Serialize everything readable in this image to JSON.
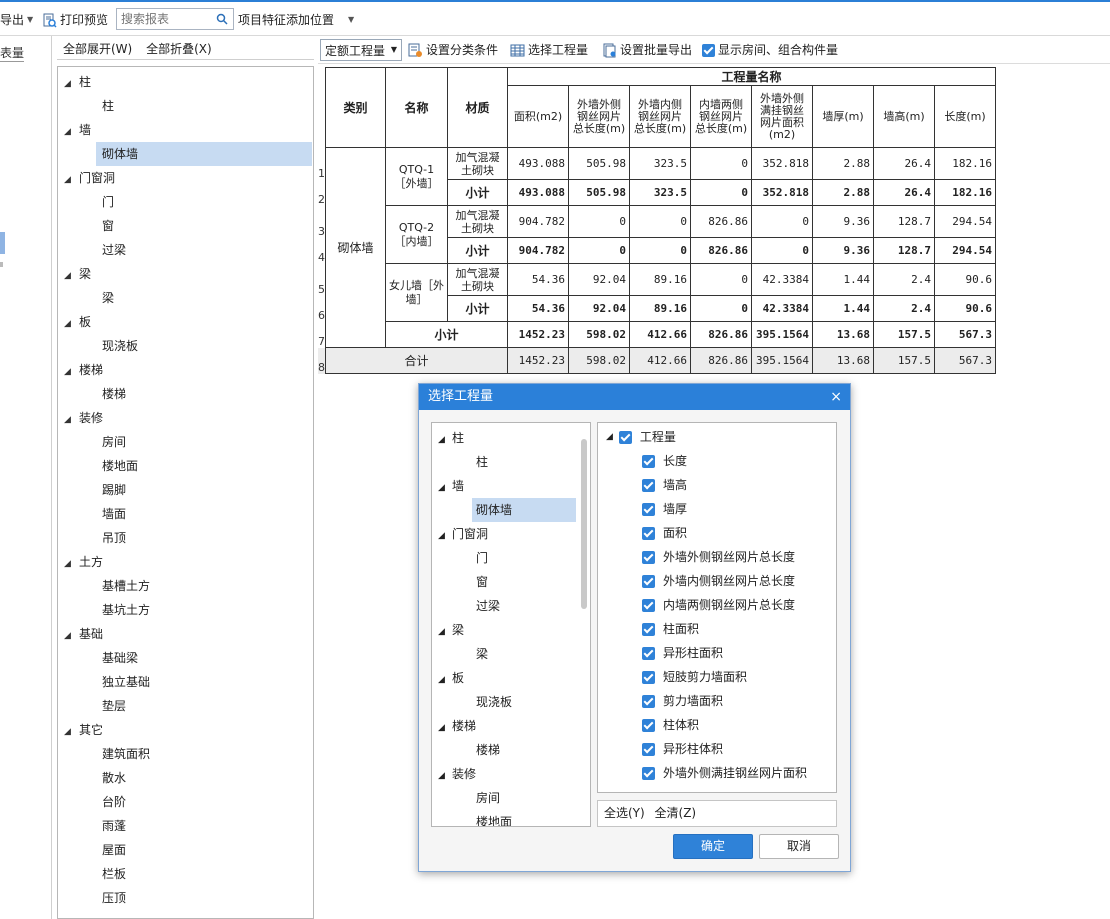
{
  "toolbar": {
    "export_label": "导出",
    "print_preview_label": "打印预览",
    "search_placeholder": "搜索报表",
    "feature_position_label": "项目特征添加位置"
  },
  "left_strip": {
    "tab_label": "表量"
  },
  "tree_panel": {
    "expand_all": "全部展开(W)",
    "collapse_all": "全部折叠(X)",
    "nodes": [
      {
        "label": "柱",
        "type": "group"
      },
      {
        "label": "柱",
        "type": "leaf"
      },
      {
        "label": "墙",
        "type": "group"
      },
      {
        "label": "砌体墙",
        "type": "leaf",
        "selected": true
      },
      {
        "label": "门窗洞",
        "type": "group"
      },
      {
        "label": "门",
        "type": "leaf"
      },
      {
        "label": "窗",
        "type": "leaf"
      },
      {
        "label": "过梁",
        "type": "leaf"
      },
      {
        "label": "梁",
        "type": "group"
      },
      {
        "label": "梁",
        "type": "leaf"
      },
      {
        "label": "板",
        "type": "group"
      },
      {
        "label": "现浇板",
        "type": "leaf"
      },
      {
        "label": "楼梯",
        "type": "group"
      },
      {
        "label": "楼梯",
        "type": "leaf"
      },
      {
        "label": "装修",
        "type": "group"
      },
      {
        "label": "房间",
        "type": "leaf"
      },
      {
        "label": "楼地面",
        "type": "leaf"
      },
      {
        "label": "踢脚",
        "type": "leaf"
      },
      {
        "label": "墙面",
        "type": "leaf"
      },
      {
        "label": "吊顶",
        "type": "leaf"
      },
      {
        "label": "土方",
        "type": "group"
      },
      {
        "label": "基槽土方",
        "type": "leaf"
      },
      {
        "label": "基坑土方",
        "type": "leaf"
      },
      {
        "label": "基础",
        "type": "group"
      },
      {
        "label": "基础梁",
        "type": "leaf"
      },
      {
        "label": "独立基础",
        "type": "leaf"
      },
      {
        "label": "垫层",
        "type": "leaf"
      },
      {
        "label": "其它",
        "type": "group"
      },
      {
        "label": "建筑面积",
        "type": "leaf"
      },
      {
        "label": "散水",
        "type": "leaf"
      },
      {
        "label": "台阶",
        "type": "leaf"
      },
      {
        "label": "雨蓬",
        "type": "leaf"
      },
      {
        "label": "屋面",
        "type": "leaf"
      },
      {
        "label": "栏板",
        "type": "leaf"
      },
      {
        "label": "压顶",
        "type": "leaf"
      }
    ]
  },
  "report_toolbar": {
    "quota_select": "定额工程量",
    "set_category": "设置分类条件",
    "select_quantity": "选择工程量",
    "batch_export": "设置批量导出",
    "show_rooms": "显示房间、组合构件量"
  },
  "table": {
    "header_group": "工程量名称",
    "col_category": "类别",
    "col_name": "名称",
    "col_material": "材质",
    "col_area": "面积(m2)",
    "col_outer_mesh": "外墙外侧钢丝网片总长度(m)",
    "col_inner_mesh": "外墙内侧钢丝网片总长度(m)",
    "col_both_mesh": "内墙两侧钢丝网片总长度(m)",
    "col_full_mesh": "外墙外侧满挂钢丝网片面积(m2)",
    "col_thickness": "墙厚(m)",
    "col_height": "墙高(m)",
    "col_length": "长度(m)",
    "category_value": "砌体墙",
    "material": "加气混凝土砌块",
    "subtotal_label": "小计",
    "total_label": "合计",
    "groups": [
      {
        "name": "QTQ-1［外墙］",
        "row": [
          "493.088",
          "505.98",
          "323.5",
          "0",
          "352.818",
          "2.88",
          "26.4",
          "182.16"
        ],
        "sub": [
          "493.088",
          "505.98",
          "323.5",
          "0",
          "352.818",
          "2.88",
          "26.4",
          "182.16"
        ]
      },
      {
        "name": "QTQ-2［内墙］",
        "row": [
          "904.782",
          "0",
          "0",
          "826.86",
          "0",
          "9.36",
          "128.7",
          "294.54"
        ],
        "sub": [
          "904.782",
          "0",
          "0",
          "826.86",
          "0",
          "9.36",
          "128.7",
          "294.54"
        ]
      },
      {
        "name": "女儿墙［外墙］",
        "row": [
          "54.36",
          "92.04",
          "89.16",
          "0",
          "42.3384",
          "1.44",
          "2.4",
          "90.6"
        ],
        "sub": [
          "54.36",
          "92.04",
          "89.16",
          "0",
          "42.3384",
          "1.44",
          "2.4",
          "90.6"
        ]
      }
    ],
    "category_subtotal": [
      "1452.23",
      "598.02",
      "412.66",
      "826.86",
      "395.1564",
      "13.68",
      "157.5",
      "567.3"
    ],
    "grand_total": [
      "1452.23",
      "598.02",
      "412.66",
      "826.86",
      "395.1564",
      "13.68",
      "157.5",
      "567.3"
    ],
    "row_numbers": [
      "1",
      "2",
      "3",
      "4",
      "5",
      "6",
      "7",
      "8"
    ]
  },
  "dialog": {
    "title": "选择工程量",
    "close": "×",
    "tree": [
      {
        "label": "柱",
        "type": "group"
      },
      {
        "label": "柱",
        "type": "leaf"
      },
      {
        "label": "墙",
        "type": "group"
      },
      {
        "label": "砌体墙",
        "type": "leaf",
        "selected": true
      },
      {
        "label": "门窗洞",
        "type": "group"
      },
      {
        "label": "门",
        "type": "leaf"
      },
      {
        "label": "窗",
        "type": "leaf"
      },
      {
        "label": "过梁",
        "type": "leaf"
      },
      {
        "label": "梁",
        "type": "group"
      },
      {
        "label": "梁",
        "type": "leaf"
      },
      {
        "label": "板",
        "type": "group"
      },
      {
        "label": "现浇板",
        "type": "leaf"
      },
      {
        "label": "楼梯",
        "type": "group"
      },
      {
        "label": "楼梯",
        "type": "leaf"
      },
      {
        "label": "装修",
        "type": "group"
      },
      {
        "label": "房间",
        "type": "leaf"
      },
      {
        "label": "楼地面",
        "type": "leaf"
      }
    ],
    "checklist_root": "工程量",
    "checklist": [
      "长度",
      "墙高",
      "墙厚",
      "面积",
      "外墙外侧钢丝网片总长度",
      "外墙内侧钢丝网片总长度",
      "内墙两侧钢丝网片总长度",
      "柱面积",
      "异形柱面积",
      "短肢剪力墙面积",
      "剪力墙面积",
      "柱体积",
      "异形柱体积",
      "外墙外侧满挂钢丝网片面积"
    ],
    "select_all": "全选(Y)",
    "clear_all": "全清(Z)",
    "ok": "确定",
    "cancel": "取消"
  },
  "colors": {
    "accent": "#2b80d9",
    "selection": "#c7dbf2"
  }
}
